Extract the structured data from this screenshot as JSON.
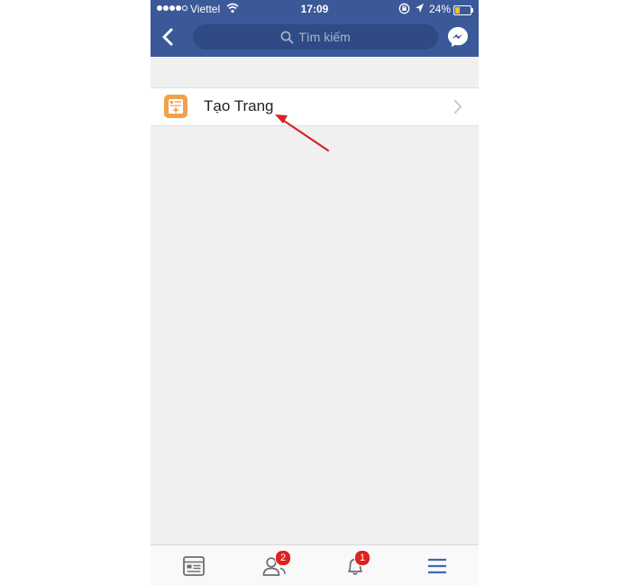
{
  "status_bar": {
    "carrier": "Viettel",
    "time": "17:09",
    "battery_percent": "24%",
    "battery_level": 0.24,
    "signal_bars": 4
  },
  "header": {
    "search_placeholder": "Tìm kiếm",
    "back_icon": "chevron-left-icon",
    "messenger_icon": "messenger-icon"
  },
  "menu": {
    "items": [
      {
        "label": "Tạo Trang",
        "icon": "create-page-icon"
      }
    ]
  },
  "tab_bar": {
    "tabs": [
      {
        "name": "news-feed",
        "icon": "news-feed-icon",
        "badge": ""
      },
      {
        "name": "friend-requests",
        "icon": "friends-icon",
        "badge": "2"
      },
      {
        "name": "notifications",
        "icon": "bell-icon",
        "badge": "1"
      },
      {
        "name": "menu",
        "icon": "hamburger-menu-icon",
        "badge": "",
        "active": true
      }
    ]
  },
  "colors": {
    "header_bg": "#3b5998",
    "search_bg": "#2f4a84",
    "page_icon": "#f3a04a",
    "badge": "#e0211d",
    "active_tab": "#4267b2",
    "annotation_arrow": "#d62222"
  }
}
